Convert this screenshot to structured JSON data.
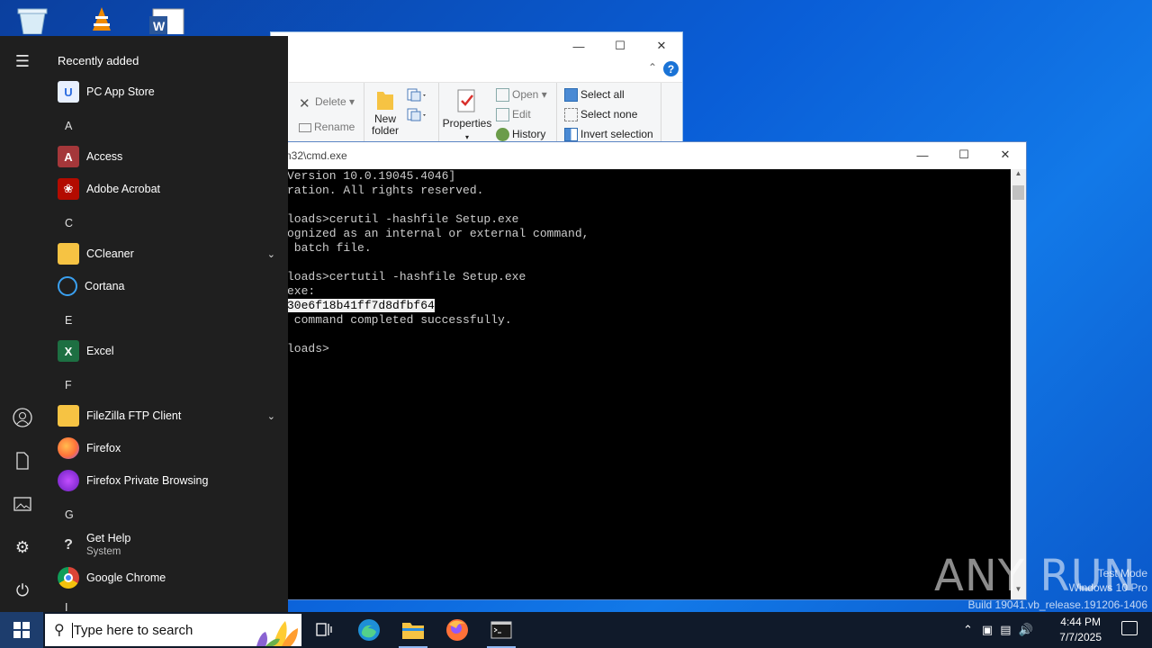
{
  "desktop": {
    "icons": [
      "recycle-bin-icon",
      "vlc-icon",
      "word-document-icon"
    ]
  },
  "explorer": {
    "ribbon": {
      "delete": "Delete",
      "rename": "Rename",
      "new_folder_1": "New",
      "new_folder_2": "folder",
      "properties": "Properties",
      "open": "Open",
      "edit": "Edit",
      "history": "History",
      "select_all": "Select all",
      "select_none": "Select none",
      "invert_selection": "Invert selection"
    },
    "help": "?"
  },
  "cmd": {
    "title": "em32\\cmd.exe",
    "lines": [
      "Version 10.0.19045.4046]",
      "ration. All rights reserved.",
      "",
      "loads>cerutil -hashfile Setup.exe",
      "ognized as an internal or external command,",
      " batch file.",
      "",
      "loads>certutil -hashfile Setup.exe",
      "exe:"
    ],
    "hash_highlight": "30e6f18b41ff7d8dfbf64",
    "line_after_hash": " command completed successfully.",
    "blank": "",
    "prompt": "loads>"
  },
  "start_menu": {
    "header": "Recently added",
    "recent": "PC App Store",
    "letters": {
      "a": "A",
      "c": "C",
      "e": "E",
      "f": "F",
      "g": "G",
      "next": "I"
    },
    "apps": {
      "access": "Access",
      "acrobat": "Adobe Acrobat",
      "ccleaner": "CCleaner",
      "cortana": "Cortana",
      "excel": "Excel",
      "filezilla": "FileZilla FTP Client",
      "firefox": "Firefox",
      "firefox_private": "Firefox Private Browsing",
      "get_help": "Get Help",
      "get_help_sub": "System",
      "chrome": "Google Chrome"
    }
  },
  "taskbar": {
    "search_placeholder": "Type here to search",
    "time": "4:44 PM",
    "date": "7/7/2025"
  },
  "watermark": {
    "brand": "ANY RUN",
    "mode": "Test Mode",
    "os": "Windows 10 Pro",
    "build": "Build 19041.vb_release.191206-1406"
  },
  "colors": {
    "accent": "#0a5ed7",
    "start_bg": "#1f1f1f",
    "taskbar_bg": "#101a2a"
  }
}
